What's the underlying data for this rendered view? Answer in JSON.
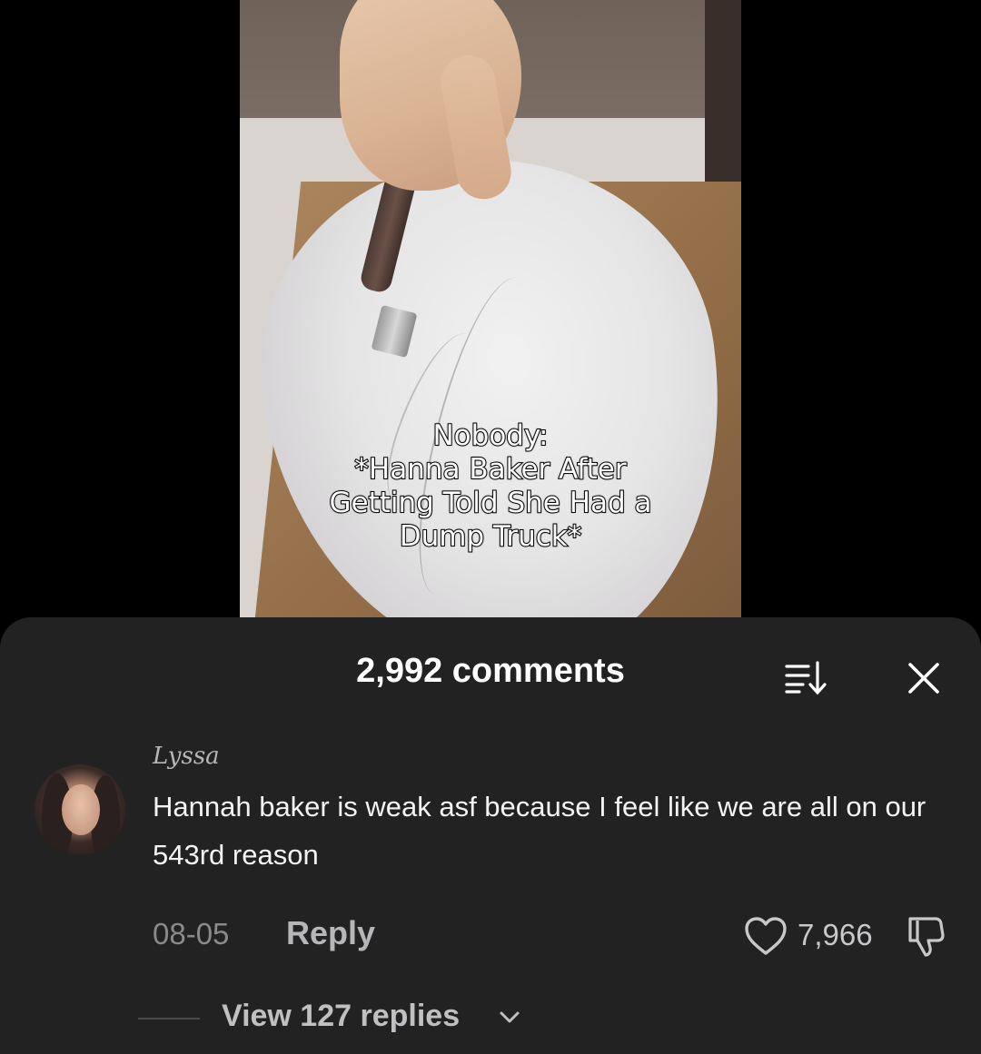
{
  "video": {
    "caption_lines": [
      "Nobody:",
      "*Hanna Baker After",
      "Getting Told She Had a",
      "Dump Truck*"
    ]
  },
  "comments_panel": {
    "title": "2,992 comments",
    "sort_icon": "sort-icon",
    "close_icon": "close-icon"
  },
  "comment": {
    "username": "Lyssa",
    "text": "Hannah baker is weak asf because I feel like we are all on our 543rd reason",
    "date": "08-05",
    "reply_label": "Reply",
    "like_count": "7,966",
    "like_icon": "heart-icon",
    "dislike_icon": "dislike-icon",
    "view_replies_label": "View 127 replies",
    "chevron_icon": "chevron-down-icon"
  },
  "colors": {
    "sheet_background": "#222223",
    "page_background": "#000000"
  }
}
